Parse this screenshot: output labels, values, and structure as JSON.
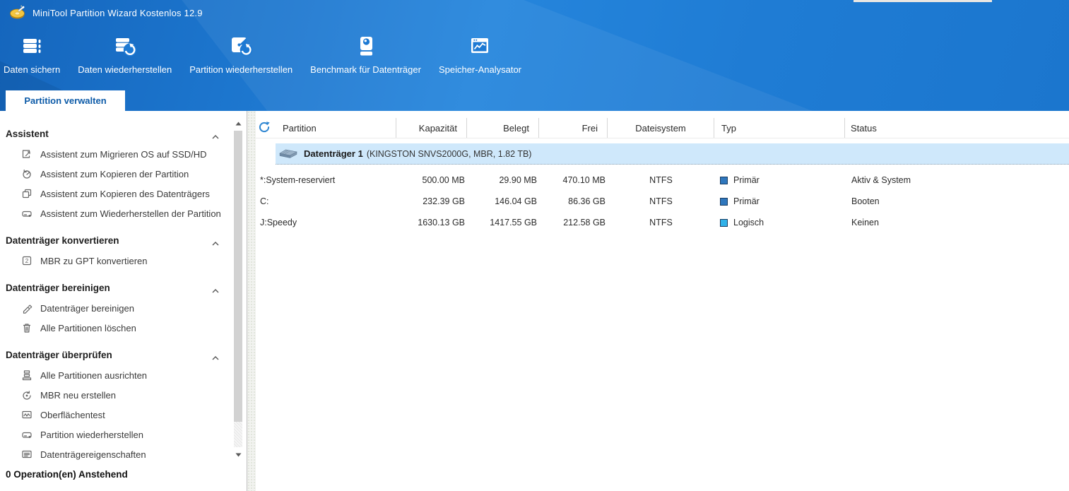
{
  "titlebar": {
    "title": "MiniTool Partition Wizard Kostenlos 12.9",
    "app_icon": "minitool-logo-icon"
  },
  "toolbar": {
    "items": [
      {
        "label": "Daten sichern",
        "icon": "backup-data-icon"
      },
      {
        "label": "Daten wiederherstellen",
        "icon": "restore-data-icon"
      },
      {
        "label": "Partition wiederherstellen",
        "icon": "restore-partition-icon"
      },
      {
        "label": "Benchmark für Datenträger",
        "icon": "disk-benchmark-icon"
      },
      {
        "label": "Speicher-Analysator",
        "icon": "space-analyzer-icon"
      }
    ]
  },
  "tab": {
    "label": "Partition verwalten"
  },
  "sidebar": {
    "sections": [
      {
        "title": "Assistent",
        "items": [
          {
            "icon": "migrate-os-wizard-icon",
            "label": "Assistent zum Migrieren OS auf SSD/HD"
          },
          {
            "icon": "copy-partition-wizard-icon",
            "label": "Assistent zum Kopieren der Partition"
          },
          {
            "icon": "copy-disk-wizard-icon",
            "label": "Assistent zum Kopieren des Datenträgers"
          },
          {
            "icon": "partition-recovery-wizard-icon",
            "label": "Assistent zum Wiederherstellen der Partition"
          }
        ]
      },
      {
        "title": "Datenträger konvertieren",
        "items": [
          {
            "icon": "mbr-to-gpt-icon",
            "label": "MBR zu GPT konvertieren"
          }
        ]
      },
      {
        "title": "Datenträger bereinigen",
        "items": [
          {
            "icon": "wipe-disk-icon",
            "label": "Datenträger bereinigen"
          },
          {
            "icon": "delete-all-partitions-icon",
            "label": "Alle Partitionen löschen"
          }
        ]
      },
      {
        "title": "Datenträger überprüfen",
        "items": [
          {
            "icon": "align-partitions-icon",
            "label": "Alle Partitionen ausrichten"
          },
          {
            "icon": "rebuild-mbr-icon",
            "label": "MBR neu erstellen"
          },
          {
            "icon": "surface-test-icon",
            "label": "Oberflächentest"
          },
          {
            "icon": "partition-recovery-icon",
            "label": "Partition wiederherstellen"
          },
          {
            "icon": "disk-properties-icon",
            "label": "Datenträgereigenschaften"
          }
        ]
      }
    ],
    "status": "0 Operation(en) Anstehend"
  },
  "table": {
    "columns": [
      "Partition",
      "Kapazität",
      "Belegt",
      "Frei",
      "Dateisystem",
      "Typ",
      "Status"
    ],
    "disk": {
      "name": "Datenträger 1",
      "details": "(KINGSTON SNVS2000G, MBR, 1.82 TB)"
    },
    "rows": [
      {
        "partition": "*:System-reserviert",
        "capacity": "500.00 MB",
        "used": "29.90 MB",
        "free": "470.10 MB",
        "filesystem": "NTFS",
        "type": "Primär",
        "type_style": "background:#2f77bd",
        "status": "Aktiv & System"
      },
      {
        "partition": "C:",
        "capacity": "232.39 GB",
        "used": "146.04 GB",
        "free": "86.36 GB",
        "filesystem": "NTFS",
        "type": "Primär",
        "type_style": "background:#2f77bd",
        "status": "Booten"
      },
      {
        "partition": "J:Speedy",
        "capacity": "1630.13 GB",
        "used": "1417.55 GB",
        "free": "212.58 GB",
        "filesystem": "NTFS",
        "type": "Logisch",
        "type_style": "background:#30b1e8",
        "status": "Keinen"
      }
    ]
  },
  "colors": {
    "header_blue": "#1e7ad2",
    "brand_text_blue": "#0d5ba8",
    "selected_row_blue": "#cfe8fb",
    "type_primary": "#2f77bd",
    "type_logical": "#30b1e8",
    "refresh_blue": "#2e86d2"
  }
}
